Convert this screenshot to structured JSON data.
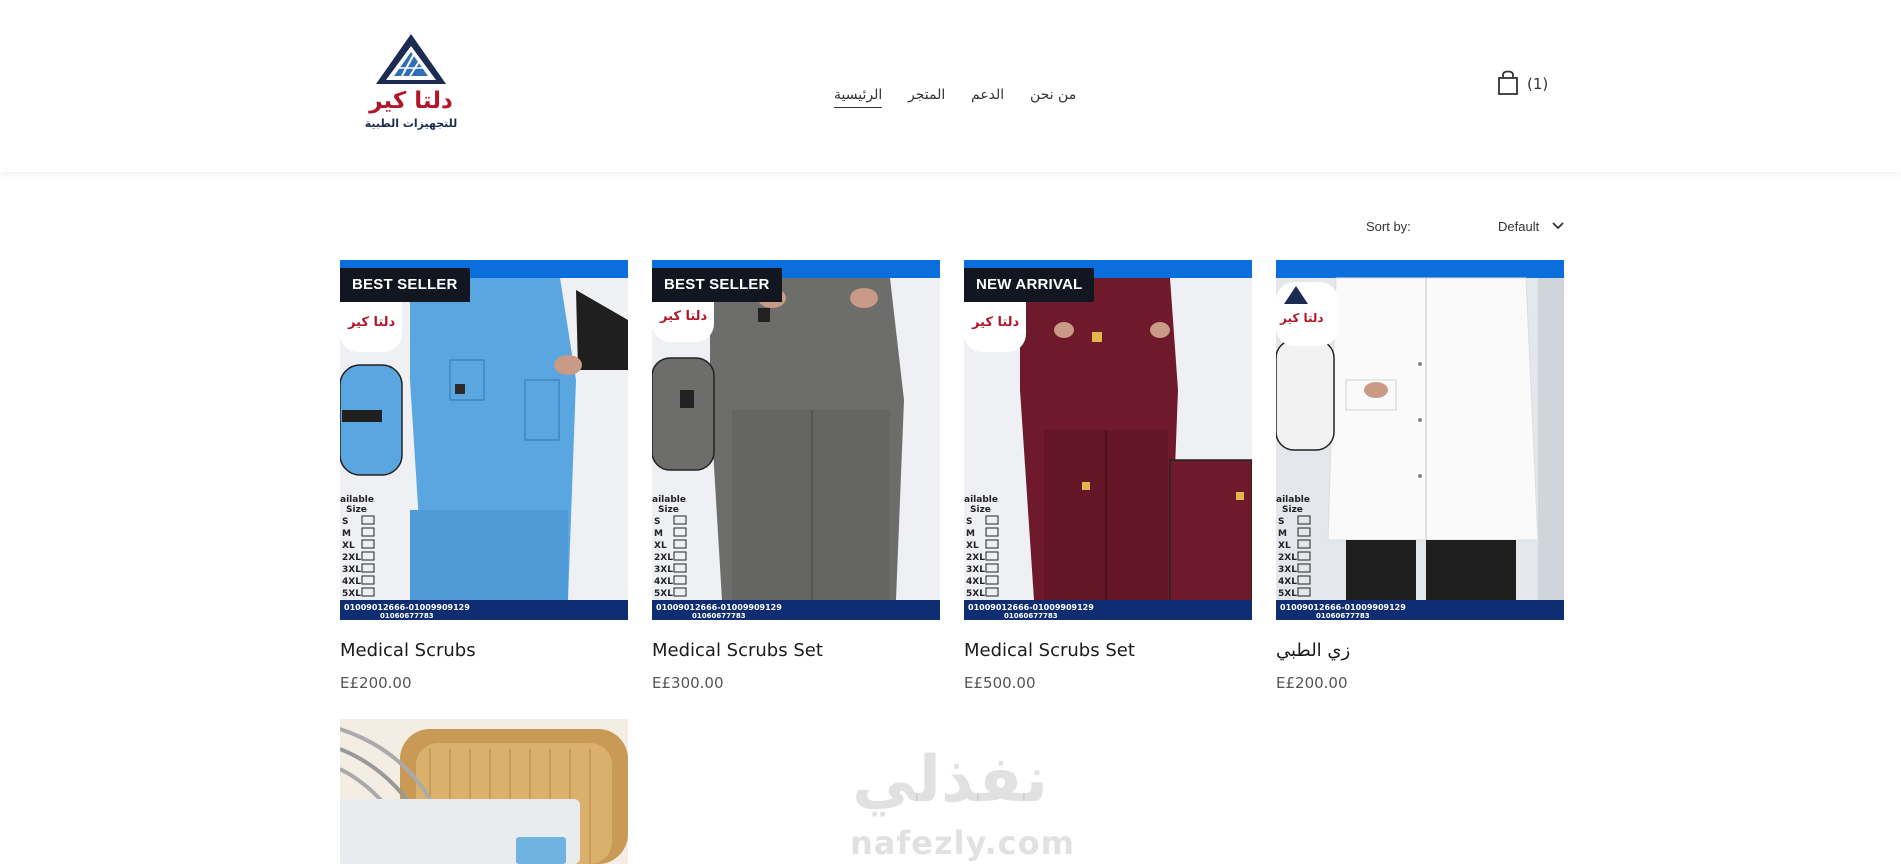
{
  "logo": {
    "brand_ar": "دلتا كير",
    "tagline_ar": "للتجهيزات الطبية"
  },
  "nav": {
    "items": [
      {
        "label": "الرئيسية",
        "active": true
      },
      {
        "label": "المتجر",
        "active": false
      },
      {
        "label": "الدعم",
        "active": false
      },
      {
        "label": "من نحن",
        "active": false
      }
    ]
  },
  "cart": {
    "count_label": "(1)",
    "icon": "shopping-bag-icon"
  },
  "sort": {
    "label": "Sort by:",
    "value": "Default",
    "icon": "chevron-down-icon"
  },
  "products": [
    {
      "name": "Medical Scrubs",
      "price": "E£200.00",
      "badge": "BEST SELLER",
      "color": "#5aa6e0"
    },
    {
      "name": "Medical Scrubs Set",
      "price": "E£300.00",
      "badge": "BEST SELLER",
      "color": "#6d6d6b"
    },
    {
      "name": "Medical Scrubs Set",
      "price": "E£500.00",
      "badge": "NEW ARRIVAL",
      "color": "#6e1a2c"
    },
    {
      "name": "زي الطبي",
      "price": "E£200.00",
      "badge": "",
      "color": "#f4f4f4"
    }
  ],
  "banner_text": {
    "phones": "01009012666-01009909129",
    "phone2": "01060677783",
    "size_label": "Available Size",
    "sizes": [
      "S",
      "M",
      "XL",
      "2XL",
      "3XL",
      "4XL",
      "5XL"
    ]
  },
  "watermark": {
    "ar": "نفذلي",
    "en": "nafezly.com"
  },
  "colors": {
    "accent_blue": "#0a6fdc",
    "badge_bg": "#121621"
  }
}
